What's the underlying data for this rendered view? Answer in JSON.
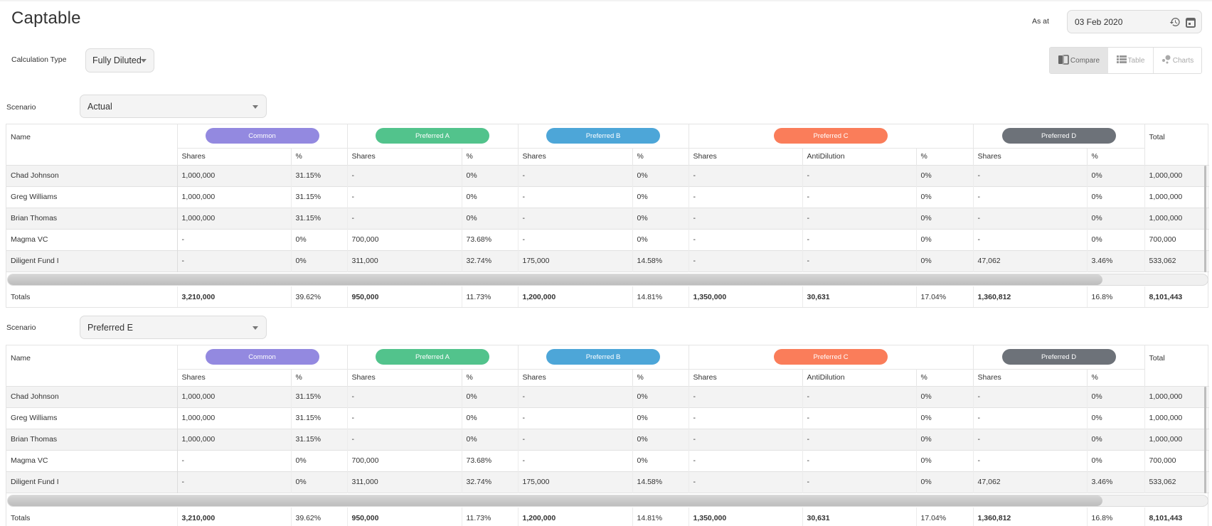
{
  "page": {
    "title": "Captable",
    "calculation_type_label": "Calculation Type",
    "calculation_type_value": "Fully Diluted",
    "as_at_label": "As at",
    "as_at_date": "03 Feb 2020",
    "icons": {
      "history": "history-icon",
      "calendar": "calendar-icon"
    },
    "views": [
      {
        "label": "Compare",
        "icon": "compare-icon",
        "active": true
      },
      {
        "label": "Table",
        "icon": "list-icon",
        "active": false
      },
      {
        "label": "Charts",
        "icon": "bubble-chart-icon",
        "active": false
      }
    ]
  },
  "colors": {
    "common": "#9389e0",
    "preferred_a": "#52c38c",
    "preferred_b": "#4da6d8",
    "preferred_c": "#fa7d5a",
    "preferred_d": "#6d7279"
  },
  "table_headers": {
    "name": "Name",
    "total": "Total",
    "classes": [
      "Common",
      "Preferred A",
      "Preferred B",
      "Preferred C",
      "Preferred D"
    ],
    "sub": [
      "Shares",
      "%",
      "Shares",
      "%",
      "Shares",
      "%",
      "Shares",
      "AntiDilution",
      "%",
      "Shares",
      "%"
    ]
  },
  "scenarios": [
    {
      "label": "Scenario",
      "value": "Actual",
      "rows": [
        [
          "Chad Johnson",
          "1,000,000",
          "31.15%",
          "-",
          "0%",
          "-",
          "0%",
          "-",
          "-",
          "0%",
          "-",
          "0%",
          "1,000,000"
        ],
        [
          "Greg Williams",
          "1,000,000",
          "31.15%",
          "-",
          "0%",
          "-",
          "0%",
          "-",
          "-",
          "0%",
          "-",
          "0%",
          "1,000,000"
        ],
        [
          "Brian Thomas",
          "1,000,000",
          "31.15%",
          "-",
          "0%",
          "-",
          "0%",
          "-",
          "-",
          "0%",
          "-",
          "0%",
          "1,000,000"
        ],
        [
          "Magma VC",
          "-",
          "0%",
          "700,000",
          "73.68%",
          "-",
          "0%",
          "-",
          "-",
          "0%",
          "-",
          "0%",
          "700,000"
        ],
        [
          "Diligent Fund I",
          "-",
          "0%",
          "311,000",
          "32.74%",
          "175,000",
          "14.58%",
          "-",
          "-",
          "0%",
          "47,062",
          "3.46%",
          "533,062"
        ]
      ],
      "totals": [
        "Totals",
        "3,210,000",
        "39.62%",
        "950,000",
        "11.73%",
        "1,200,000",
        "14.81%",
        "1,350,000",
        "30,631",
        "17.04%",
        "1,360,812",
        "16.8%",
        "8,101,443"
      ]
    },
    {
      "label": "Scenario",
      "value": "Preferred E",
      "rows": [
        [
          "Chad Johnson",
          "1,000,000",
          "31.15%",
          "-",
          "0%",
          "-",
          "0%",
          "-",
          "-",
          "0%",
          "-",
          "0%",
          "1,000,000"
        ],
        [
          "Greg Williams",
          "1,000,000",
          "31.15%",
          "-",
          "0%",
          "-",
          "0%",
          "-",
          "-",
          "0%",
          "-",
          "0%",
          "1,000,000"
        ],
        [
          "Brian Thomas",
          "1,000,000",
          "31.15%",
          "-",
          "0%",
          "-",
          "0%",
          "-",
          "-",
          "0%",
          "-",
          "0%",
          "1,000,000"
        ],
        [
          "Magma VC",
          "-",
          "0%",
          "700,000",
          "73.68%",
          "-",
          "0%",
          "-",
          "-",
          "0%",
          "-",
          "0%",
          "700,000"
        ],
        [
          "Diligent Fund I",
          "-",
          "0%",
          "311,000",
          "32.74%",
          "175,000",
          "14.58%",
          "-",
          "-",
          "0%",
          "47,062",
          "3.46%",
          "533,062"
        ]
      ],
      "totals": [
        "Totals",
        "3,210,000",
        "39.62%",
        "950,000",
        "11.73%",
        "1,200,000",
        "14.81%",
        "1,350,000",
        "30,631",
        "17.04%",
        "1,360,812",
        "16.8%",
        "8,101,443"
      ]
    }
  ]
}
